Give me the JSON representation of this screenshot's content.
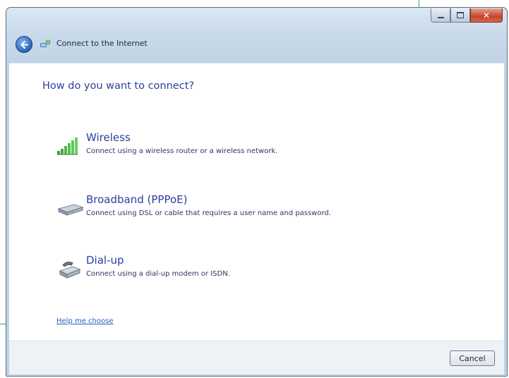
{
  "window": {
    "title": "Connect to the Internet",
    "close_glyph": "✕"
  },
  "content": {
    "heading": "How do you want to connect?",
    "options": [
      {
        "title": "Wireless",
        "description": "Connect using a wireless router or a wireless network.",
        "icon": "wireless-signal-icon"
      },
      {
        "title": "Broadband (PPPoE)",
        "description": "Connect using DSL or cable that requires a user name and password.",
        "icon": "broadband-modem-icon"
      },
      {
        "title": "Dial-up",
        "description": "Connect using a dial-up modem or ISDN.",
        "icon": "dialup-phone-icon"
      }
    ],
    "help_link": "Help me choose"
  },
  "footer": {
    "cancel_label": "Cancel"
  },
  "colors": {
    "heading": "#2d3f9c",
    "link": "#2a5bbf",
    "close_button": "#c4452c"
  }
}
